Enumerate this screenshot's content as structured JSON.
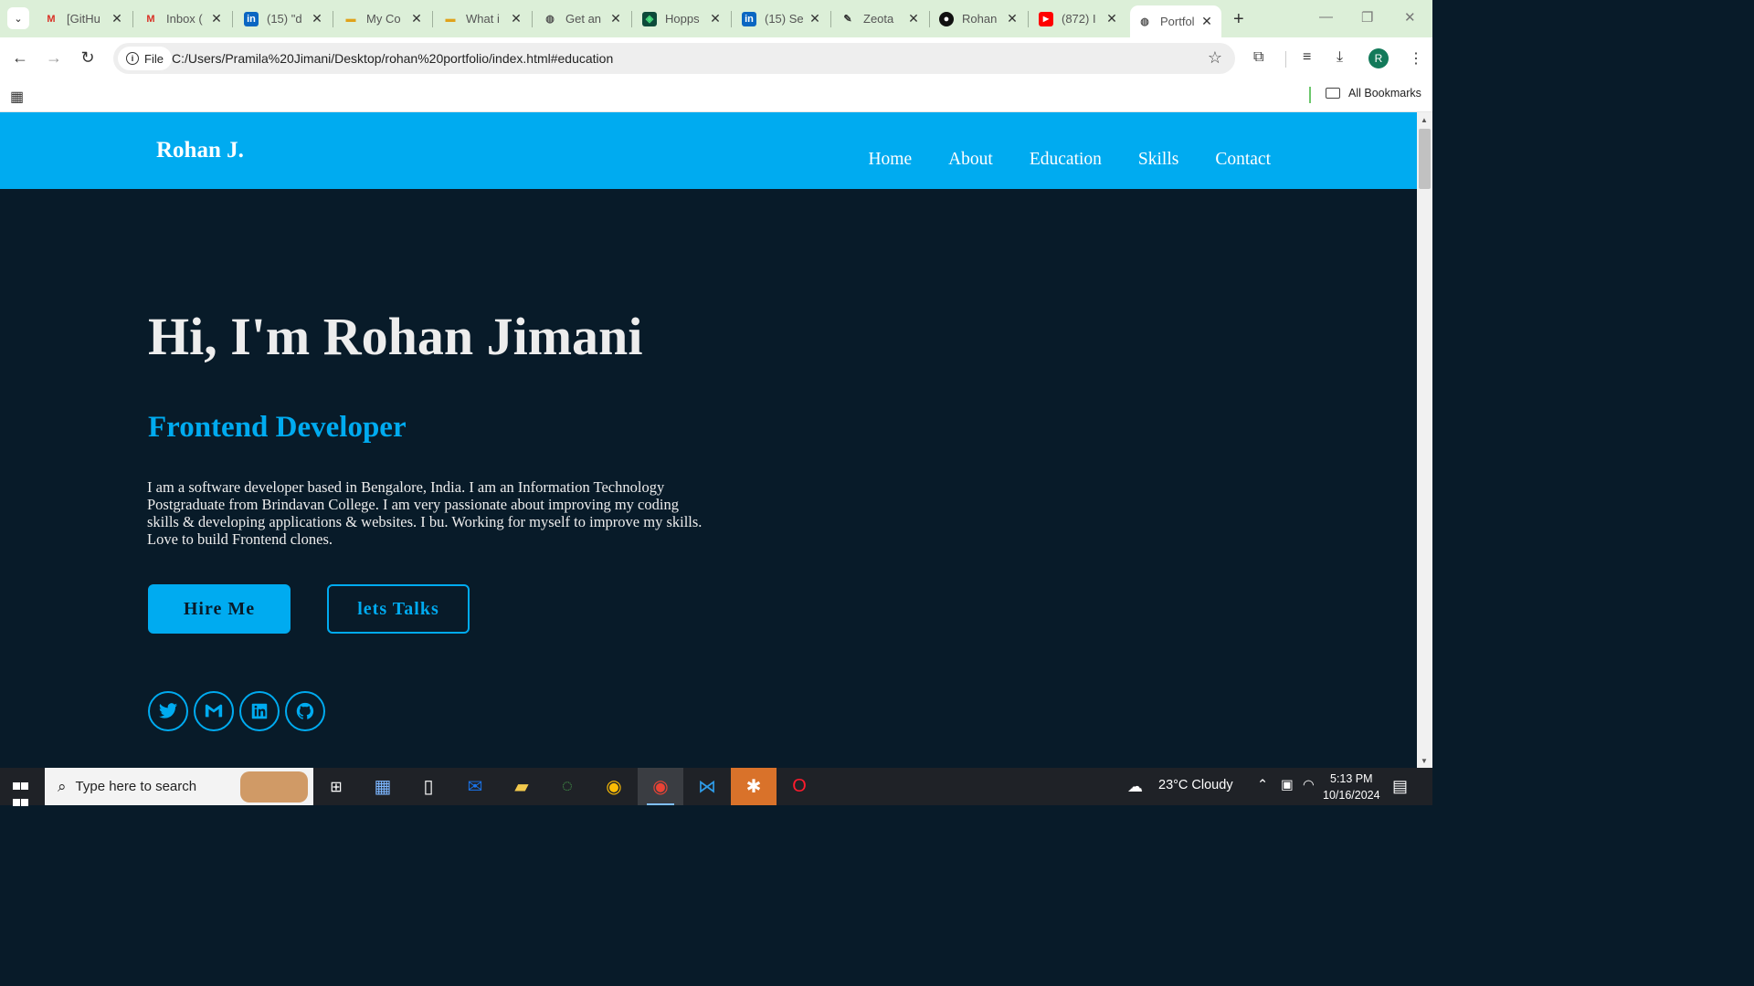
{
  "browser": {
    "tabs": [
      {
        "title": "[GitHu",
        "favicon": "gmail-icon",
        "color": "#d93025"
      },
      {
        "title": "Inbox (",
        "favicon": "gmail-icon",
        "color": "#d93025"
      },
      {
        "title": "(15) \"d",
        "favicon": "linkedin-icon",
        "color": "#0a66c2"
      },
      {
        "title": "My Co",
        "favicon": "hackerrank-icon",
        "color": "#e0a21b"
      },
      {
        "title": "What i",
        "favicon": "hackerrank-icon",
        "color": "#e0a21b"
      },
      {
        "title": "Get an",
        "favicon": "globe-icon",
        "color": "#555555"
      },
      {
        "title": "Hopps",
        "favicon": "hoppscotch-icon",
        "color": "#0d4a3a"
      },
      {
        "title": "(15) Se",
        "favicon": "linkedin-icon",
        "color": "#0a66c2"
      },
      {
        "title": "Zeota",
        "favicon": "edit-icon",
        "color": "#333333"
      },
      {
        "title": "Rohan",
        "favicon": "github-icon",
        "color": "#111111"
      },
      {
        "title": "(872) I",
        "favicon": "youtube-icon",
        "color": "#ff0000"
      },
      {
        "title": "Portfol",
        "favicon": "globe-icon",
        "color": "#555555",
        "active": true
      }
    ],
    "address": {
      "chip": "File",
      "url": "C:/Users/Pramila%20Jimani/Desktop/rohan%20portfolio/index.html#education"
    },
    "bookmarks": {
      "all_label": "All Bookmarks"
    },
    "profile_initial": "R"
  },
  "site": {
    "logo": "Rohan J.",
    "nav": [
      "Home",
      "About",
      "Education",
      "Skills",
      "Contact"
    ],
    "hero": {
      "title": "Hi, I'm Rohan Jimani",
      "subtitle": "Frontend Developer",
      "text": "I am a software developer based in Bengalore, India. I am an Information Technology Postgraduate from Brindavan College. I am very passionate about improving my coding skills & developing applications & websites. I bu. Working for myself to improve my skills. Love to build Frontend clones.",
      "hire_label": "Hire Me",
      "talk_label": "lets Talks"
    },
    "socials": [
      "twitter-icon",
      "gmail-icon",
      "linkedin-icon",
      "github-icon"
    ],
    "colors": {
      "accent": "#00abf0",
      "background": "#081b29",
      "text": "#ededed"
    }
  },
  "taskbar": {
    "search_placeholder": "Type here to search",
    "weather": "23°C  Cloudy",
    "time": "5:13 PM",
    "date": "10/16/2024"
  }
}
